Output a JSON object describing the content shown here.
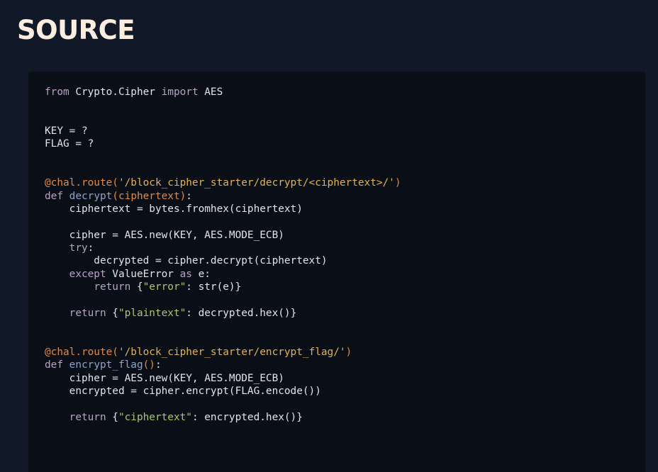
{
  "page": {
    "title": "SOURCE"
  },
  "colors": {
    "background": "#111827",
    "code_background": "#0a0e17",
    "text": "#e2e4e9",
    "keyword": "#b8a3c6",
    "decorator": "#e08a47",
    "route_string": "#e0b25c",
    "dict_string": "#a9c675",
    "function_name": "#8fa3c7"
  },
  "code": {
    "language": "python",
    "lines": [
      [
        [
          "kw",
          "from"
        ],
        [
          "pl",
          " Crypto.Cipher "
        ],
        [
          "kw",
          "import"
        ],
        [
          "pl",
          " AES"
        ]
      ],
      [],
      [],
      [
        [
          "pl",
          "KEY = ?"
        ]
      ],
      [
        [
          "pl",
          "FLAG = ?"
        ]
      ],
      [],
      [],
      [
        [
          "dec",
          "@chal.route("
        ],
        [
          "str",
          "'/block_cipher_starter/decrypt/<ciphertext>/'"
        ],
        [
          "dec",
          ")"
        ]
      ],
      [
        [
          "kw",
          "def"
        ],
        [
          "pl",
          " "
        ],
        [
          "fn",
          "decrypt"
        ],
        [
          "par",
          "(ciphertext)"
        ],
        [
          "pl",
          ":"
        ]
      ],
      [
        [
          "pl",
          "    ciphertext = bytes.fromhex(ciphertext)"
        ]
      ],
      [],
      [
        [
          "pl",
          "    cipher = AES.new(KEY, AES.MODE_ECB)"
        ]
      ],
      [
        [
          "pl",
          "    "
        ],
        [
          "kw",
          "try"
        ],
        [
          "pl",
          ":"
        ]
      ],
      [
        [
          "pl",
          "        decrypted = cipher.decrypt(ciphertext)"
        ]
      ],
      [
        [
          "pl",
          "    "
        ],
        [
          "kw",
          "except"
        ],
        [
          "pl",
          " ValueError "
        ],
        [
          "kw",
          "as"
        ],
        [
          "pl",
          " e:"
        ]
      ],
      [
        [
          "pl",
          "        "
        ],
        [
          "kw",
          "return"
        ],
        [
          "pl",
          " {"
        ],
        [
          "str2",
          "\"error\""
        ],
        [
          "pl",
          ": str(e)}"
        ]
      ],
      [],
      [
        [
          "pl",
          "    "
        ],
        [
          "kw",
          "return"
        ],
        [
          "pl",
          " {"
        ],
        [
          "str2",
          "\"plaintext\""
        ],
        [
          "pl",
          ": decrypted.hex()}"
        ]
      ],
      [],
      [],
      [
        [
          "dec",
          "@chal.route("
        ],
        [
          "str",
          "'/block_cipher_starter/encrypt_flag/'"
        ],
        [
          "dec",
          ")"
        ]
      ],
      [
        [
          "kw",
          "def"
        ],
        [
          "pl",
          " "
        ],
        [
          "fn",
          "encrypt_flag"
        ],
        [
          "par",
          "()"
        ],
        [
          "pl",
          ":"
        ]
      ],
      [
        [
          "pl",
          "    cipher = AES.new(KEY, AES.MODE_ECB)"
        ]
      ],
      [
        [
          "pl",
          "    encrypted = cipher.encrypt(FLAG.encode())"
        ]
      ],
      [],
      [
        [
          "pl",
          "    "
        ],
        [
          "kw",
          "return"
        ],
        [
          "pl",
          " {"
        ],
        [
          "str2",
          "\"ciphertext\""
        ],
        [
          "pl",
          ": encrypted.hex()}"
        ]
      ]
    ]
  }
}
